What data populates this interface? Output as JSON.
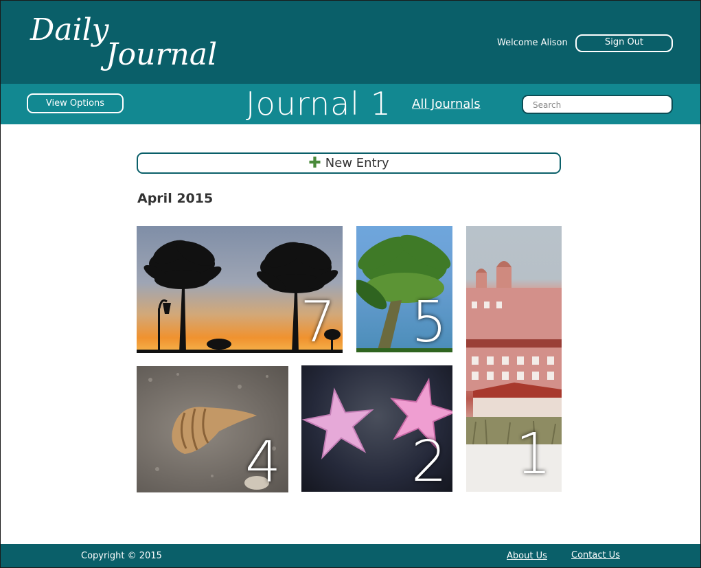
{
  "header": {
    "logo_line1": "Daily",
    "logo_line2": "Journal",
    "welcome": "Welcome Alison",
    "signout_label": "Sign Out"
  },
  "toolbar": {
    "view_options_label": "View Options",
    "journal_title": "Journal 1",
    "all_journals_label": "All Journals",
    "search_placeholder": "Search"
  },
  "main": {
    "new_entry_label": "New Entry",
    "month_heading": "April 2015",
    "entries": [
      {
        "day": "7",
        "scene": "sunset palm trees"
      },
      {
        "day": "5",
        "scene": "palm tree"
      },
      {
        "day": "1",
        "scene": "pink hotel"
      },
      {
        "day": "4",
        "scene": "seashell on sand"
      },
      {
        "day": "2",
        "scene": "starfish"
      }
    ]
  },
  "footer": {
    "copyright": "Copyright © 2015",
    "about_label": "About Us",
    "contact_label": "Contact Us"
  },
  "colors": {
    "header_bg": "#0a5f69",
    "subbar_bg": "#128891",
    "accent_plus": "#4a8a3a"
  }
}
